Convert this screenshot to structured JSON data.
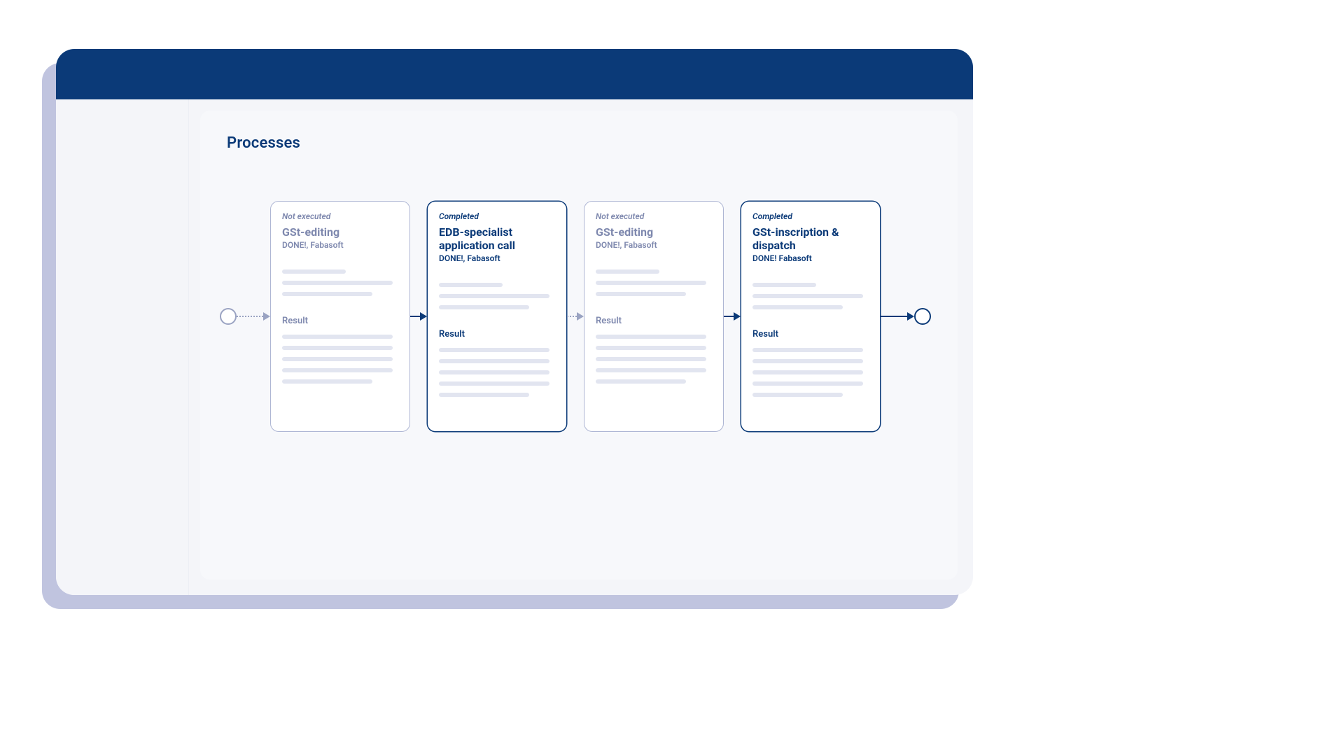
{
  "colors": {
    "primary": "#0b3a78",
    "muted": "#7e88ae",
    "skeleton": "#e2e5f0",
    "shadow": "#8c93c4",
    "window_bg": "#f4f5f9",
    "panel_bg": "#f7f8fb"
  },
  "page": {
    "title": "Processes"
  },
  "flow": {
    "start_node": true,
    "end_node": true,
    "connectors": [
      {
        "style": "dotted",
        "tone": "muted"
      },
      {
        "style": "solid",
        "tone": "strong"
      },
      {
        "style": "dotted",
        "tone": "muted"
      },
      {
        "style": "solid",
        "tone": "strong"
      },
      {
        "style": "solid",
        "tone": "strong"
      }
    ],
    "cards": [
      {
        "status": "Not executed",
        "title": "GSt-editing",
        "subtitle": "DONE!, Fabasoft",
        "result_label": "Result",
        "tone": "muted"
      },
      {
        "status": "Completed",
        "title": "EDB-specialist application call",
        "subtitle": "DONE!, Fabasoft",
        "result_label": "Result",
        "tone": "strong"
      },
      {
        "status": "Not executed",
        "title": "GSt-editing",
        "subtitle": "DONE!, Fabasoft",
        "result_label": "Result",
        "tone": "muted"
      },
      {
        "status": "Completed",
        "title": "GSt-inscription & dispatch",
        "subtitle": "DONE! Fabasoft",
        "result_label": "Result",
        "tone": "strong"
      }
    ]
  }
}
